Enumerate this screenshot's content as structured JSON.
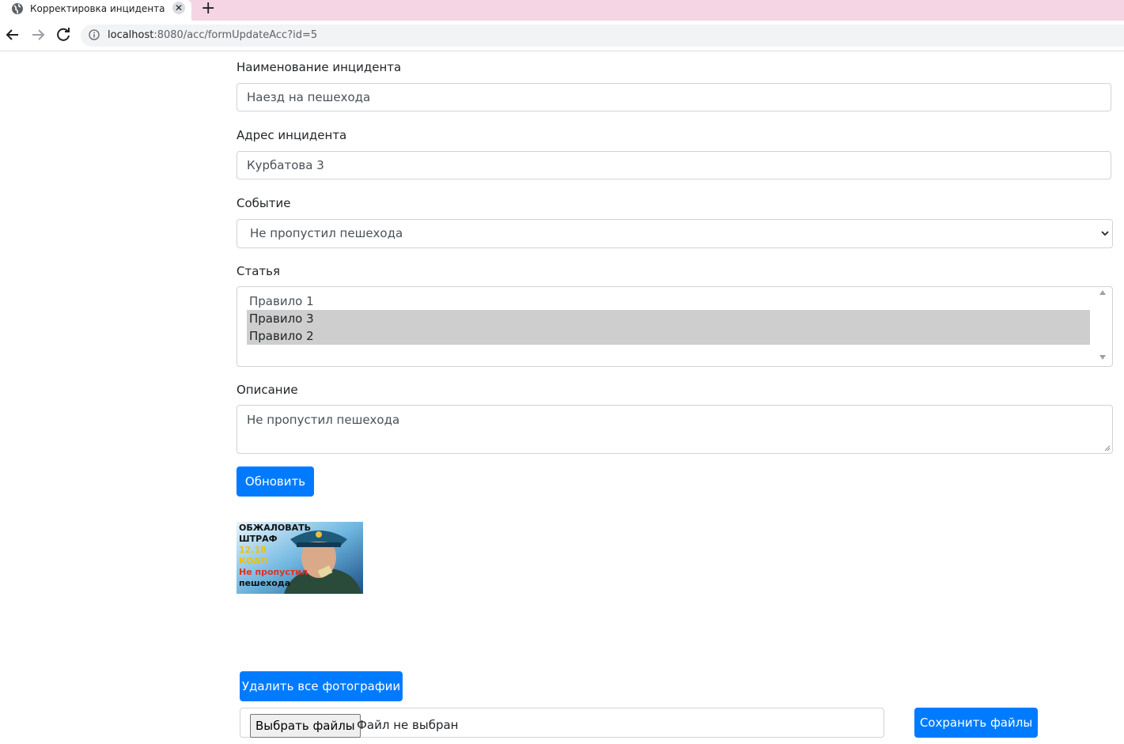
{
  "browser": {
    "tab_title": "Корректировка инцидента",
    "tab_close": "✕",
    "new_tab": "+",
    "url_host": "localhost",
    "url_path": ":8080/acc/formUpdateAcc?id=5"
  },
  "form": {
    "name_label": "Наименование инцидента",
    "name_value": "Наезд на пешехода",
    "address_label": "Адрес инцидента",
    "address_value": "Курбатова 3",
    "event_label": "Событие",
    "event_value": "Не пропустил пешехода",
    "article_label": "Статья",
    "article_options": [
      {
        "label": "Правило 1",
        "selected": false
      },
      {
        "label": "Правило 3",
        "selected": true
      },
      {
        "label": "Правило 2",
        "selected": true
      }
    ],
    "description_label": "Описание",
    "description_value": "Не пропустил пешехода",
    "update_button": "Обновить"
  },
  "photo": {
    "caption_lines": [
      "ОБЖАЛОВАТЬ",
      "ШТРАФ",
      "12.18",
      "КОАП",
      "Не пропустил",
      "пешехода"
    ]
  },
  "files": {
    "delete_all_button": "Удалить все фотографии",
    "choose_button": "Выбрать файлы",
    "status": "Файл не выбран",
    "save_button": "Сохранить файлы"
  },
  "colors": {
    "primary": "#007bff",
    "tab_strip": "#f5d5e3",
    "selected_option": "#cecece"
  }
}
